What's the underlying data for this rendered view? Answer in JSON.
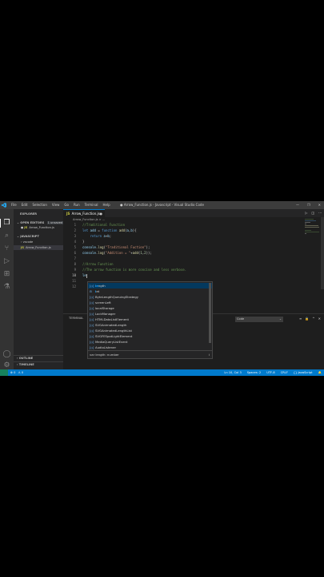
{
  "window": {
    "title": "● Arrow_Function.js - Javascript - Visual Studio Code",
    "menu": [
      "File",
      "Edit",
      "Selection",
      "View",
      "Go",
      "Run",
      "Terminal",
      "Help"
    ],
    "controls": [
      "—",
      "❐",
      "✕"
    ]
  },
  "activity_bar": {
    "icons": [
      "explorer-icon",
      "search-icon",
      "source-control-icon",
      "run-debug-icon",
      "extensions-icon",
      "testing-icon"
    ],
    "bottom_icons": [
      "account-icon",
      "manage-gear-icon"
    ]
  },
  "sidebar": {
    "title": "EXPLORER",
    "more": "···",
    "open_editors": {
      "label": "OPEN EDITORS",
      "badge": "1 unsaved"
    },
    "open_file": "Arrow_Function.js",
    "folder": "JAVASCRIPT",
    "tree": [
      {
        "label": "vscode",
        "type": "folder"
      },
      {
        "label": "Arrow_Function.js",
        "type": "file"
      }
    ],
    "outline": "OUTLINE",
    "timeline": "TIMELINE"
  },
  "editor": {
    "tab": {
      "label": "Arrow_Function.js",
      "close": "●"
    },
    "tab_actions": [
      "▷",
      "◫",
      "···"
    ],
    "breadcrumb": "Arrow_Function.js > ...",
    "lines": [
      {
        "n": "1",
        "code": "//Traditional Function"
      },
      {
        "n": "2",
        "code": "let add = function add(a,b){"
      },
      {
        "n": "3",
        "code": "    return a+b;"
      },
      {
        "n": "4",
        "code": "}"
      },
      {
        "n": "5",
        "code": "console.log(\"Traditional Fuction\");"
      },
      {
        "n": "6",
        "code": "console.log(\"Addition = \"+add(1,2));"
      },
      {
        "n": "7",
        "code": ""
      },
      {
        "n": "8",
        "code": "//Arrow Function"
      },
      {
        "n": "9",
        "code": "//The arrow function is more concise and less verbose."
      },
      {
        "n": "10",
        "code": "le"
      },
      {
        "n": "11",
        "code": ""
      },
      {
        "n": "12",
        "code": ""
      }
    ]
  },
  "suggestions": {
    "items": [
      {
        "match": "le",
        "rest": "ngth",
        "full": "length"
      },
      {
        "match": "l",
        "rest": "et",
        "full": "let"
      },
      {
        "match": "",
        "rest": "ByteLengthQueuingStrategy",
        "full": "ByteLengthQueuingStrategy"
      },
      {
        "match": "",
        "rest": "screenLeft",
        "full": "screenLeft"
      },
      {
        "match": "",
        "rest": "localStorage",
        "full": "localStorage"
      },
      {
        "match": "",
        "rest": "LockManager",
        "full": "LockManager"
      },
      {
        "match": "",
        "rest": "HTMLDataListElement",
        "full": "HTMLDataListElement"
      },
      {
        "match": "",
        "rest": "SVGAnimatedLength",
        "full": "SVGAnimatedLength"
      },
      {
        "match": "",
        "rest": "SVGAnimatedLengthList",
        "full": "SVGAnimatedLengthList"
      },
      {
        "match": "",
        "rest": "SVGFESpotLightElement",
        "full": "SVGFESpotLightElement"
      },
      {
        "match": "",
        "rest": "MediaQueryListEvent",
        "full": "MediaQueryListEvent"
      },
      {
        "match": "",
        "rest": "AudioListener",
        "full": "AudioListener"
      }
    ],
    "detail": "var length: number",
    "detail_icon": "i"
  },
  "panel": {
    "tab": "TERMINAL",
    "select": "Code",
    "actions": [
      "≡",
      "🔒",
      "^",
      "✕"
    ]
  },
  "status": {
    "left": [
      "⊗ 0",
      "⚠ 0"
    ],
    "right": [
      "Ln 10, Col 3",
      "Spaces: 2",
      "UTF-8",
      "CRLF",
      "{} JavaScript",
      "🔔"
    ]
  },
  "colors": {
    "accent": "#007acc",
    "status_bar": "#007acc",
    "editor_bg": "#1e1e1e",
    "sidebar_bg": "#252526"
  }
}
